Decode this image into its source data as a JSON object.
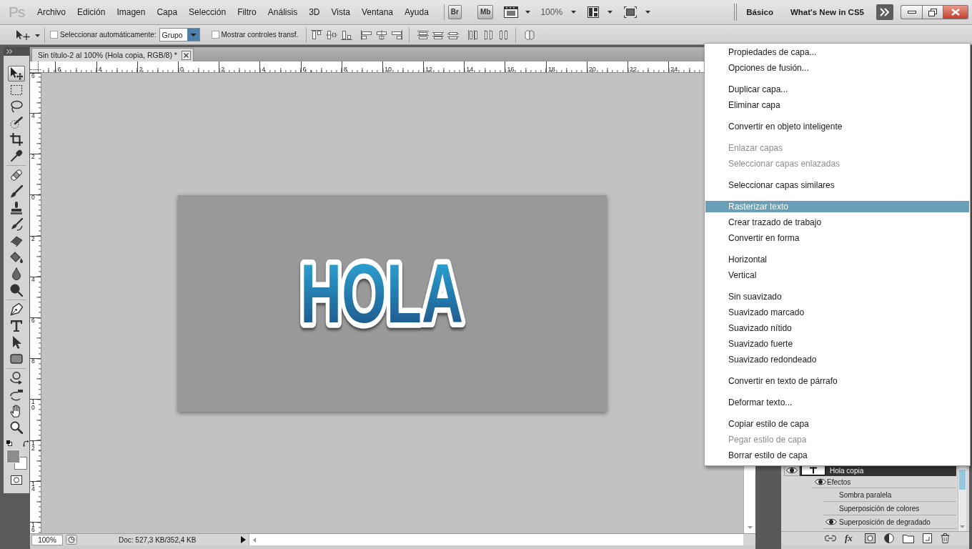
{
  "menu_bar": {
    "logo": "Ps",
    "menus": [
      "Archivo",
      "Edición",
      "Imagen",
      "Capa",
      "Selección",
      "Filtro",
      "Análisis",
      "3D",
      "Vista",
      "Ventana",
      "Ayuda"
    ],
    "launchers": [
      "Br",
      "Mb"
    ],
    "zoom": "100%",
    "workspaces": [
      "Básico",
      "What's New in CS5"
    ]
  },
  "options_bar": {
    "auto_select": {
      "label": "Seleccionar automáticamente:",
      "checked": false,
      "value": "Grupo"
    },
    "show_transform": {
      "label": "Mostrar controles transf.",
      "checked": false
    }
  },
  "tools": {
    "groups": [
      {
        "items": [
          {
            "kind": "move",
            "selected": true
          },
          {
            "kind": "marquee",
            "selected": false
          },
          {
            "kind": "lasso",
            "selected": false
          },
          {
            "kind": "quick-selection",
            "selected": false
          },
          {
            "kind": "crop",
            "selected": false
          },
          {
            "kind": "eyedropper",
            "selected": false
          }
        ]
      },
      {
        "items": [
          {
            "kind": "healing",
            "selected": false
          },
          {
            "kind": "brush",
            "selected": false
          },
          {
            "kind": "stamp",
            "selected": false
          },
          {
            "kind": "history-brush",
            "selected": false
          },
          {
            "kind": "eraser",
            "selected": false
          },
          {
            "kind": "bucket",
            "selected": false
          },
          {
            "kind": "blur",
            "selected": false
          },
          {
            "kind": "dodge",
            "selected": false
          }
        ]
      },
      {
        "items": [
          {
            "kind": "pen",
            "selected": false
          },
          {
            "kind": "type",
            "selected": false
          },
          {
            "kind": "path-selection",
            "selected": false
          },
          {
            "kind": "shape",
            "selected": false
          }
        ]
      },
      {
        "items": [
          {
            "kind": "rotate-3d",
            "selected": false
          },
          {
            "kind": "orbit-3d",
            "selected": false
          },
          {
            "kind": "hand",
            "selected": false
          },
          {
            "kind": "zoom",
            "selected": false
          }
        ]
      }
    ]
  },
  "document": {
    "tab": "Sin título-2 al 100% (Hola copia, RGB/8) *",
    "ruler_h": [
      "6",
      "4",
      "2",
      "0",
      "2",
      "4",
      "6",
      "8",
      "10",
      "12",
      "14",
      "16",
      "18",
      "20",
      "22",
      "24"
    ],
    "ruler_v": [
      "6",
      "4",
      "2",
      "0",
      "2",
      "4",
      "6",
      "8",
      "10",
      "12",
      "14",
      "16"
    ],
    "canvas_text": "HOLA"
  },
  "status_bar": {
    "zoom": "100%",
    "info": "Doc: 527,3 KB/352,4 KB"
  },
  "layers_panel": {
    "layers": [
      {
        "name": "Hola copia",
        "visible": true,
        "selected": true,
        "effects": {
          "label": "Efectos",
          "visible": true,
          "items": [
            {
              "name": "Sombra paralela",
              "visible": false
            },
            {
              "name": "Superposición de colores",
              "visible": false
            },
            {
              "name": "Superposición de degradado",
              "visible": true
            }
          ]
        }
      }
    ],
    "fx": "fx"
  },
  "context_menu": {
    "groups": [
      {
        "items": [
          {
            "label": "Propiedades de capa...",
            "selected": false,
            "disabled": false
          },
          {
            "label": "Opciones de fusión...",
            "selected": false,
            "disabled": false
          }
        ]
      },
      {
        "items": [
          {
            "label": "Duplicar capa...",
            "selected": false,
            "disabled": false
          },
          {
            "label": "Eliminar capa",
            "selected": false,
            "disabled": false
          }
        ]
      },
      {
        "items": [
          {
            "label": "Convertir en objeto inteligente",
            "selected": false,
            "disabled": false
          }
        ]
      },
      {
        "items": [
          {
            "label": "Enlazar capas",
            "selected": false,
            "disabled": true
          },
          {
            "label": "Seleccionar capas enlazadas",
            "selected": false,
            "disabled": true
          }
        ]
      },
      {
        "items": [
          {
            "label": "Seleccionar capas similares",
            "selected": false,
            "disabled": false
          }
        ]
      },
      {
        "items": [
          {
            "label": "Rasterizar texto",
            "selected": true,
            "disabled": false
          },
          {
            "label": "Crear trazado de trabajo",
            "selected": false,
            "disabled": false
          },
          {
            "label": "Convertir en forma",
            "selected": false,
            "disabled": false
          }
        ]
      },
      {
        "items": [
          {
            "label": "Horizontal",
            "selected": false,
            "disabled": false
          },
          {
            "label": "Vertical",
            "selected": false,
            "disabled": false
          }
        ]
      },
      {
        "items": [
          {
            "label": "Sin suavizado",
            "selected": false,
            "disabled": false
          },
          {
            "label": "Suavizado marcado",
            "selected": false,
            "disabled": false
          },
          {
            "label": "Suavizado nítido",
            "selected": false,
            "disabled": false
          },
          {
            "label": "Suavizado fuerte",
            "selected": false,
            "disabled": false
          },
          {
            "label": "Suavizado redondeado",
            "selected": false,
            "disabled": false
          }
        ]
      },
      {
        "items": [
          {
            "label": "Convertir en texto de párrafo",
            "selected": false,
            "disabled": false
          }
        ]
      },
      {
        "items": [
          {
            "label": "Deformar texto...",
            "selected": false,
            "disabled": false
          }
        ]
      },
      {
        "items": [
          {
            "label": "Copiar estilo de capa",
            "selected": false,
            "disabled": false
          },
          {
            "label": "Pegar estilo de capa",
            "selected": false,
            "disabled": true
          },
          {
            "label": "Borrar estilo de capa",
            "selected": false,
            "disabled": false
          }
        ]
      }
    ]
  }
}
